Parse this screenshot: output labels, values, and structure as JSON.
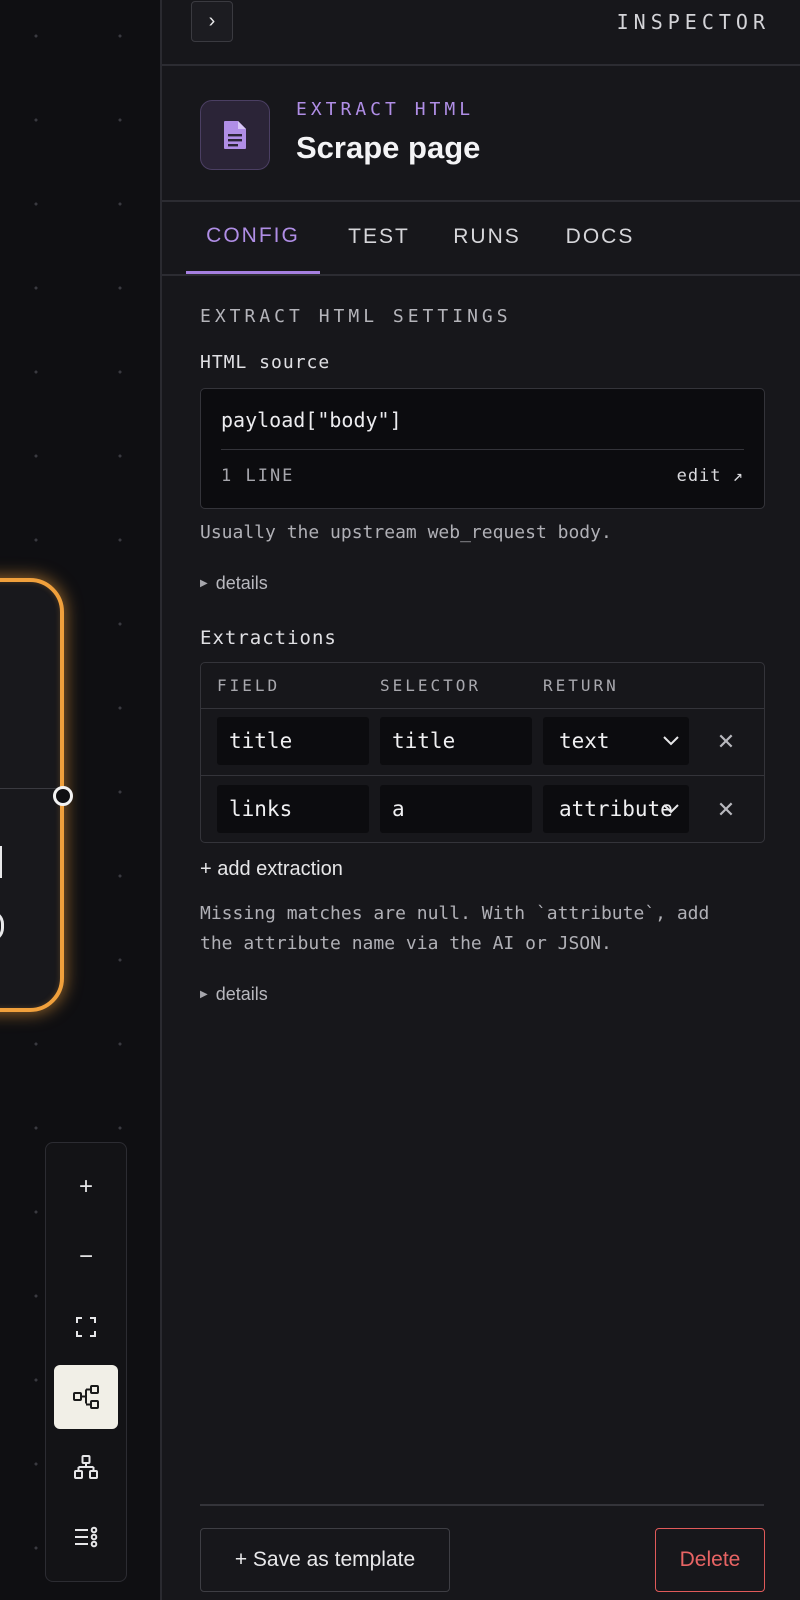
{
  "inspector": {
    "title": "INSPECTOR",
    "collapse_glyph": "›"
  },
  "node": {
    "type": "EXTRACT HTML",
    "name": "Scrape page",
    "icon": "document-icon"
  },
  "tabs": [
    {
      "label": "CONFIG",
      "active": true
    },
    {
      "label": "TEST",
      "active": false
    },
    {
      "label": "RUNS",
      "active": false
    },
    {
      "label": "DOCS",
      "active": false
    }
  ],
  "settings": {
    "title": "EXTRACT HTML SETTINGS",
    "html_source": {
      "label": "HTML source",
      "code": "payload[\"body\"]",
      "line_count": "1 LINE",
      "edit_label": "edit ↗",
      "help": "Usually the upstream web_request body.",
      "details_label": "details"
    },
    "extractions": {
      "label": "Extractions",
      "columns": [
        "FIELD",
        "SELECTOR",
        "RETURN"
      ],
      "rows": [
        {
          "field": "title",
          "selector": "title",
          "return": "text"
        },
        {
          "field": "links",
          "selector": "a",
          "return": "attribute"
        }
      ],
      "add_label": "+ add extraction",
      "help_line1": "Missing matches are null. With `attribute`, add",
      "help_line2": "the attribute name via the AI or JSON.",
      "details_label": "details"
    }
  },
  "footer": {
    "save_template_label": "+ Save as template",
    "delete_label": "Delete"
  },
  "toolbar": {
    "buttons": [
      {
        "name": "zoom-in-icon",
        "glyph": "+"
      },
      {
        "name": "zoom-out-icon",
        "glyph": "−"
      },
      {
        "name": "fit-view-icon"
      },
      {
        "name": "layout-horizontal-icon",
        "active": true
      },
      {
        "name": "layout-vertical-icon"
      },
      {
        "name": "list-settings-icon"
      }
    ]
  },
  "colors": {
    "accent": "#b08ee6",
    "node_border": "#f0a03c",
    "danger": "#e86464",
    "background": "#17171b"
  }
}
